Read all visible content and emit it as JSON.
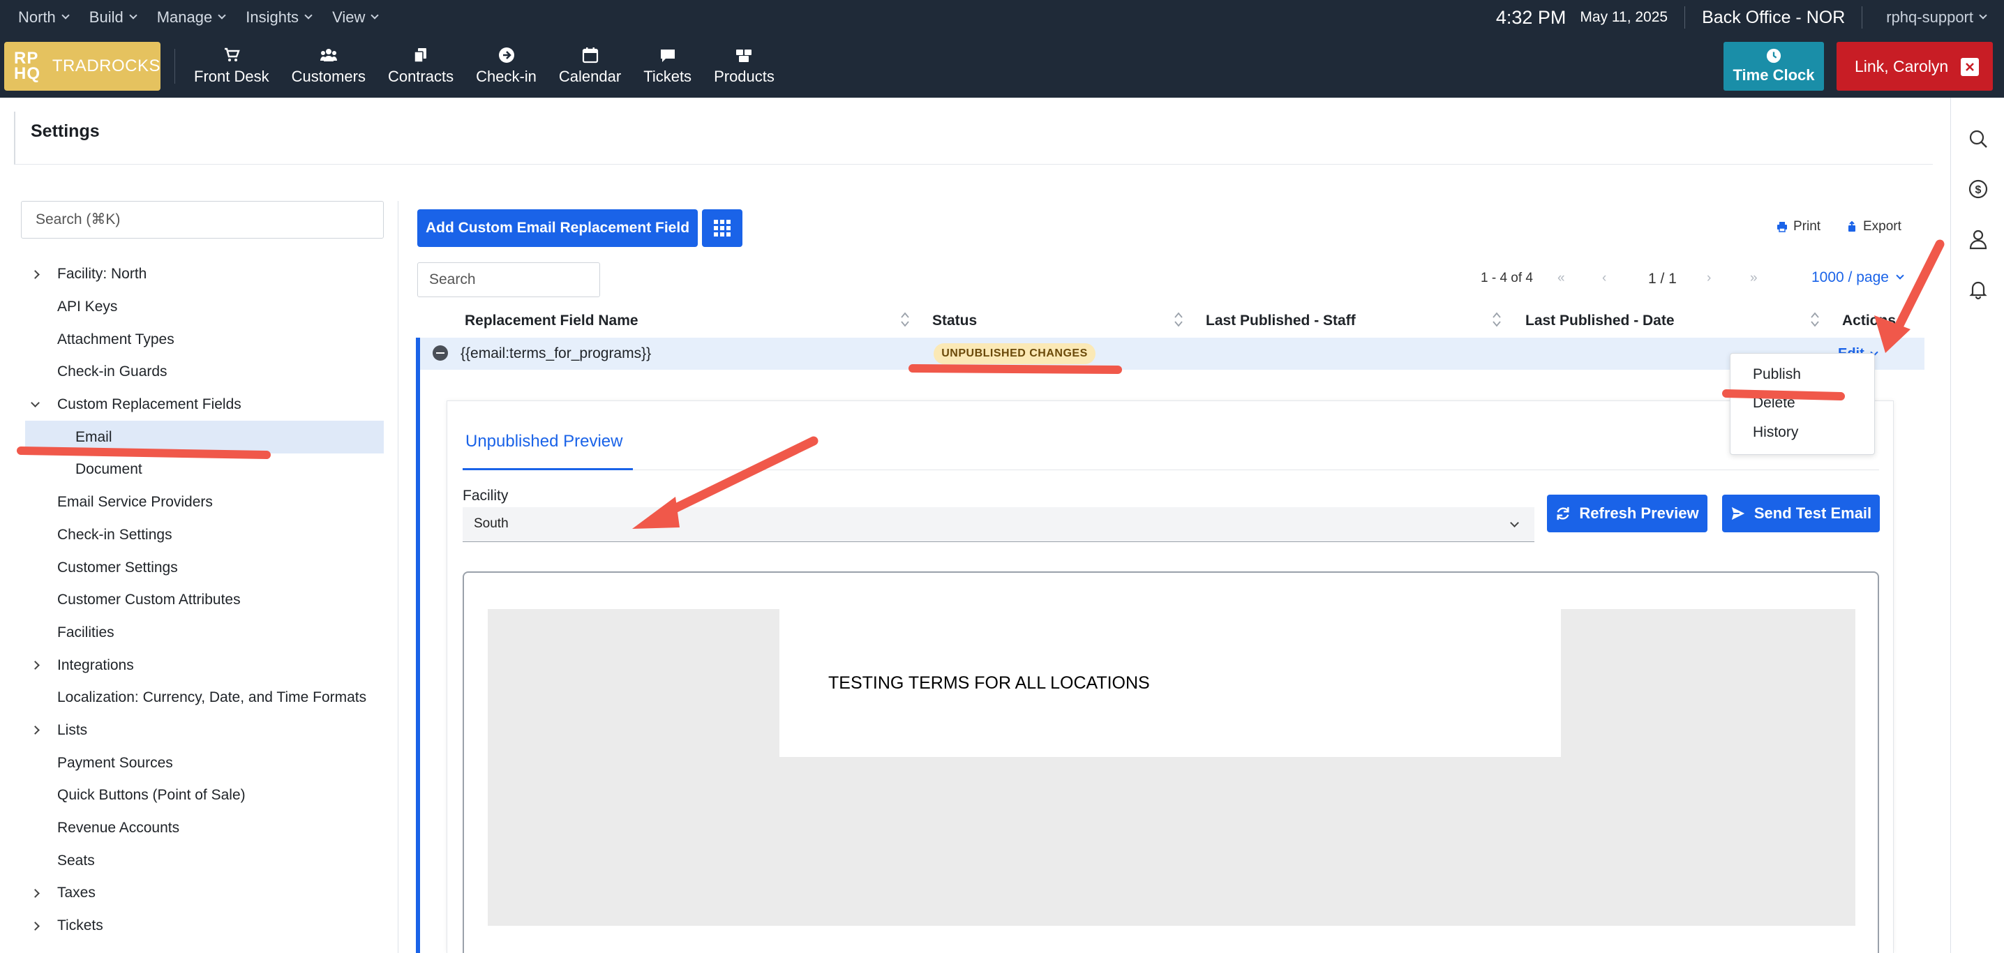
{
  "menubar": {
    "menus": [
      {
        "label": "North"
      },
      {
        "label": "Build"
      },
      {
        "label": "Manage"
      },
      {
        "label": "Insights"
      },
      {
        "label": "View"
      }
    ],
    "time": "4:32 PM",
    "date": "May 11, 2025",
    "office": "Back Office - NOR",
    "user": "rphq-support"
  },
  "navbar": {
    "logo_mark": "RP HQ",
    "logo_name": "TRADROCKS",
    "items": [
      {
        "label": "Front Desk",
        "icon": "cart-icon"
      },
      {
        "label": "Customers",
        "icon": "users-icon"
      },
      {
        "label": "Contracts",
        "icon": "contracts-icon"
      },
      {
        "label": "Check-in",
        "icon": "arrow-circle-icon"
      },
      {
        "label": "Calendar",
        "icon": "calendar-icon"
      },
      {
        "label": "Tickets",
        "icon": "speech-bubble-icon"
      },
      {
        "label": "Products",
        "icon": "boxes-icon"
      }
    ],
    "time_clock": "Time Clock",
    "current_user": "Link, Carolyn"
  },
  "settings": {
    "title": "Settings",
    "search_placeholder": "Search (⌘K)",
    "items": [
      {
        "label": "Facility: North",
        "expandable": true
      },
      {
        "label": "API Keys"
      },
      {
        "label": "Attachment Types"
      },
      {
        "label": "Check-in Guards"
      },
      {
        "label": "Custom Replacement Fields",
        "expandable": true,
        "open": true
      },
      {
        "label": "Email",
        "sub": true,
        "active": true
      },
      {
        "label": "Document",
        "sub": true
      },
      {
        "label": "Email Service Providers"
      },
      {
        "label": "Check-in Settings"
      },
      {
        "label": "Customer Settings"
      },
      {
        "label": "Customer Custom Attributes"
      },
      {
        "label": "Facilities"
      },
      {
        "label": "Integrations",
        "expandable": true
      },
      {
        "label": "Localization: Currency, Date, and Time Formats"
      },
      {
        "label": "Lists",
        "expandable": true
      },
      {
        "label": "Payment Sources"
      },
      {
        "label": "Quick Buttons (Point of Sale)"
      },
      {
        "label": "Revenue Accounts"
      },
      {
        "label": "Seats"
      },
      {
        "label": "Taxes",
        "expandable": true
      },
      {
        "label": "Tickets",
        "expandable": true
      }
    ]
  },
  "main": {
    "add_button": "Add Custom Email Replacement Field",
    "print": "Print",
    "export": "Export",
    "search_placeholder": "Search",
    "range": "1 - 4 of 4",
    "page": "1 / 1",
    "per_page": "1000 / page",
    "columns": [
      "Replacement Field Name",
      "Status",
      "Last Published - Staff",
      "Last Published - Date",
      "Actions"
    ],
    "row": {
      "name": "{{email:terms_for_programs}}",
      "status": "UNPUBLISHED CHANGES",
      "action": "Edit"
    },
    "actions_menu": [
      "Publish",
      "Delete",
      "History"
    ],
    "preview": {
      "tab": "Unpublished Preview",
      "facility_label": "Facility",
      "facility_value": "South",
      "refresh_button": "Refresh Preview",
      "send_button": "Send Test Email",
      "body_text": "TESTING TERMS FOR ALL LOCATIONS"
    }
  },
  "colors": {
    "topbar": "#1f2a38",
    "accent": "#1a63e8",
    "logo": "#e5c25f",
    "time_clock": "#1a8ea8",
    "user_button": "#c81d25",
    "annotation": "#f0584a"
  }
}
